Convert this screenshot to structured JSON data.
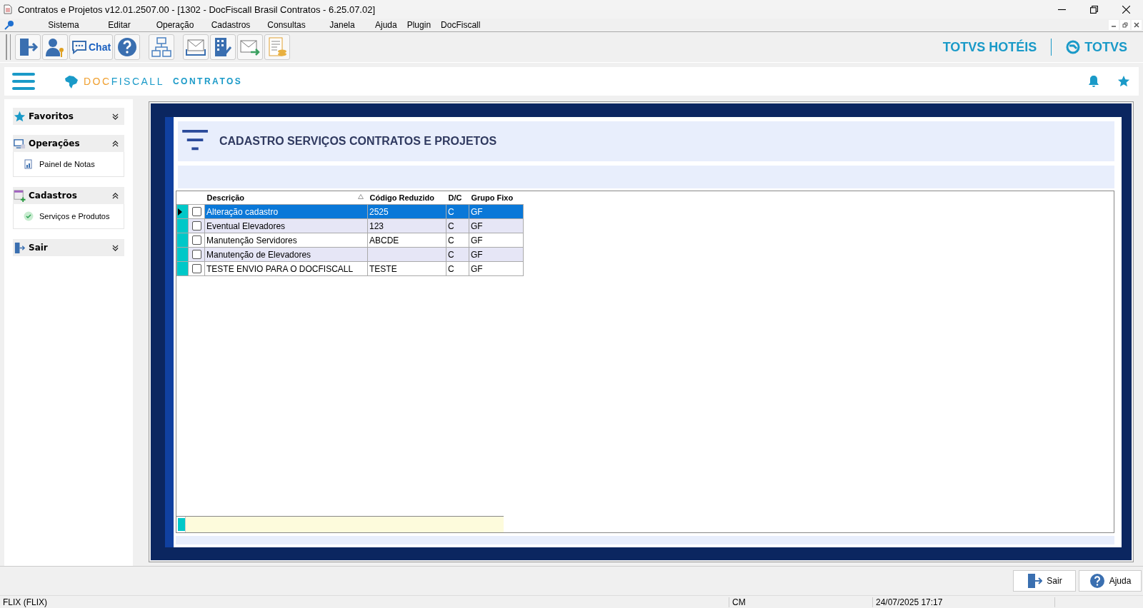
{
  "window": {
    "title": "Contratos e Projetos v12.01.2507.00 - [1302 - DocFiscall Brasil Contratos - 6.25.07.02]"
  },
  "menu": [
    "Sistema",
    "Editar",
    "Operação",
    "Cadastros",
    "Consultas",
    "Janela",
    "Ajuda",
    "Plugin",
    "DocFiscall"
  ],
  "toolbar": [
    {
      "kind": "exit"
    },
    {
      "kind": "user"
    },
    {
      "kind": "chat",
      "label": "Chat"
    },
    {
      "kind": "help"
    },
    {
      "kind": "org"
    },
    {
      "kind": "mail"
    },
    {
      "kind": "building"
    },
    {
      "kind": "send"
    },
    {
      "kind": "money"
    }
  ],
  "brand": {
    "left": "TOTVS HOTÉIS",
    "right": "TOTVS"
  },
  "header": {
    "logo_prefix": "DOC",
    "logo_name": "FISCALL",
    "product": "CONTRATOS"
  },
  "sidebar": [
    {
      "label": "Favoritos",
      "kind": "star",
      "expanded": false
    },
    {
      "label": "Operações",
      "kind": "monitor",
      "expanded": true,
      "children": [
        {
          "label": "Painel de Notas",
          "kind": "report"
        }
      ]
    },
    {
      "label": "Cadastros",
      "kind": "table",
      "expanded": true,
      "children": [
        {
          "label": "Serviços e Produtos",
          "kind": "check"
        }
      ]
    },
    {
      "label": "Sair",
      "kind": "exit",
      "expanded": false
    }
  ],
  "page": {
    "title": "CADASTRO SERVIÇOS CONTRATOS E PROJETOS"
  },
  "table": {
    "columns": [
      "Descrição",
      "Código Reduzido",
      "D/C",
      "Grupo Fixo"
    ],
    "rows": [
      {
        "selected": true,
        "checked": false,
        "cells": [
          "Alteração cadastro",
          "2525",
          "C",
          "GF"
        ]
      },
      {
        "selected": false,
        "checked": false,
        "cells": [
          "Eventual Elevadores",
          "123",
          "C",
          "GF"
        ]
      },
      {
        "selected": false,
        "checked": false,
        "cells": [
          "Manutenção Servidores",
          "ABCDE",
          "C",
          "GF"
        ]
      },
      {
        "selected": false,
        "checked": false,
        "cells": [
          "Manutenção de Elevadores",
          "",
          "C",
          "GF"
        ]
      },
      {
        "selected": false,
        "checked": false,
        "cells": [
          "TESTE ENVIO PARA O DOCFISCALL",
          "TESTE",
          "C",
          "GF"
        ]
      }
    ]
  },
  "buttons": [
    {
      "kind": "exit",
      "label": "Sair"
    },
    {
      "kind": "help",
      "label": "Ajuda"
    }
  ],
  "status_bar": [
    "FLIX (FLIX)",
    "CM",
    "24/07/2025 17:17"
  ]
}
